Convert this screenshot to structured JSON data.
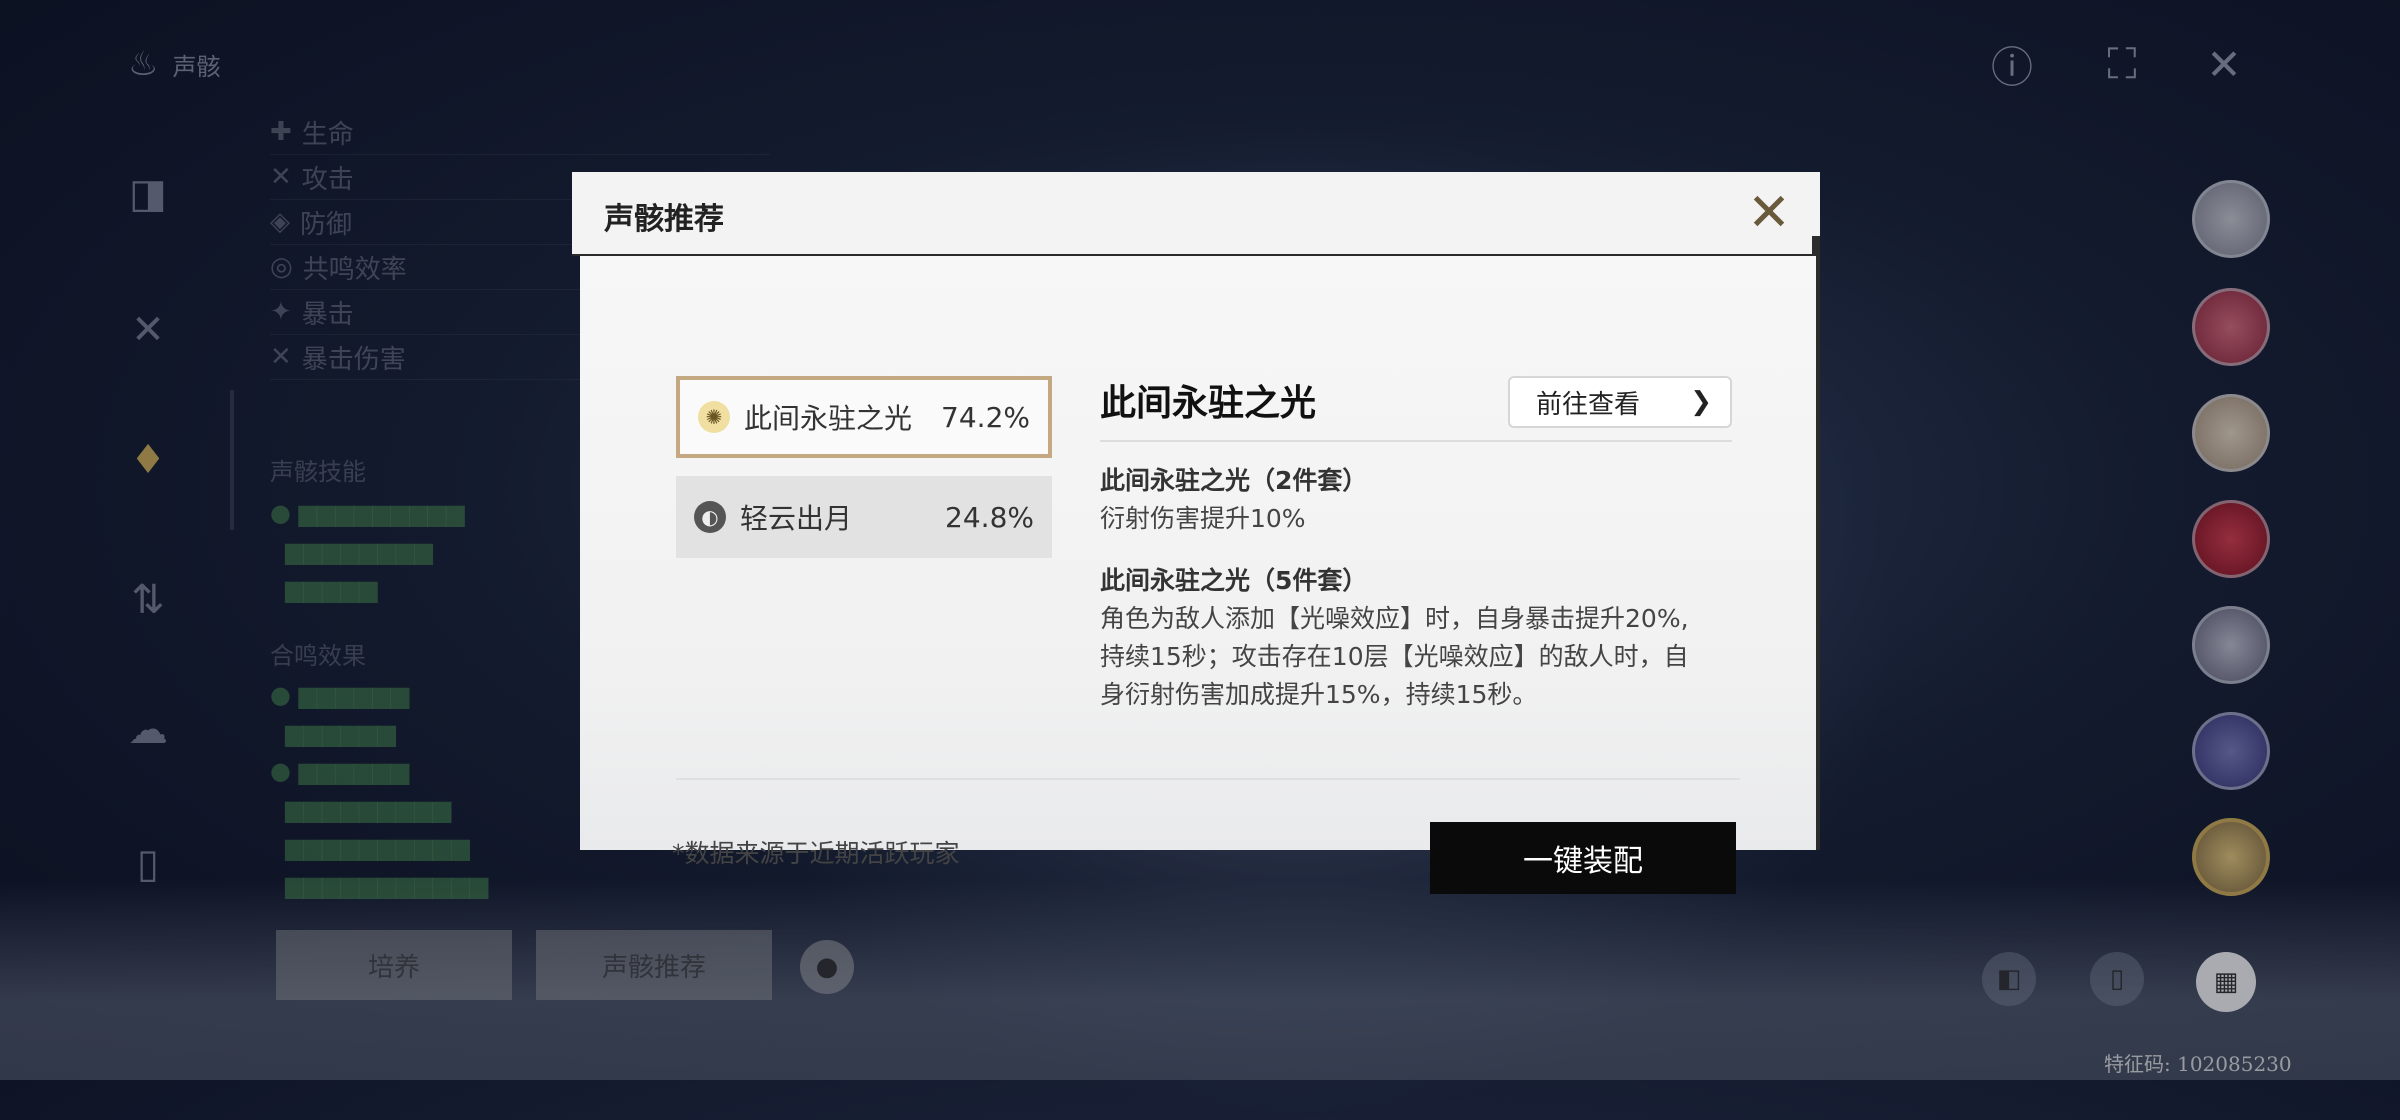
{
  "background": {
    "rail_top_label": "声骸",
    "stats_rows": [
      "生命",
      "攻击",
      "防御",
      "共鸣效率",
      "暴击",
      "暴击伤害"
    ],
    "effects_heading": "声骸技能",
    "set_heading": "合鸣效果",
    "bottom_buttons": [
      "培养",
      "声骸推荐"
    ],
    "uid": "特征码: 102085230"
  },
  "dialog": {
    "title": "声骸推荐",
    "sets": [
      {
        "name": "此间永驻之光",
        "percent": "74.2%",
        "icon": "sun-icon",
        "active": true
      },
      {
        "name": "轻云出月",
        "percent": "24.8%",
        "icon": "moon-icon",
        "active": false
      }
    ],
    "selected_title": "此间永驻之光",
    "goto_label": "前往查看",
    "bonus2_heading": "此间永驻之光（2件套）",
    "bonus2_text": "衍射伤害提升10%",
    "bonus5_heading": "此间永驻之光（5件套）",
    "bonus5_line1": "角色为敌人添加【光噪效应】时，自身暴击提升20%,",
    "bonus5_line2": "持续15秒；攻击存在10层【光噪效应】的敌人时，自",
    "bonus5_line3": "身衍射伤害加成提升15%，持续15秒。",
    "note": "*数据来源于近期活跃玩家",
    "equip_label": "一键装配"
  },
  "colors": {
    "active_border": "#c4a882",
    "equip_button": "#0a0a0a",
    "avatar_selected": "#d8b35a"
  }
}
